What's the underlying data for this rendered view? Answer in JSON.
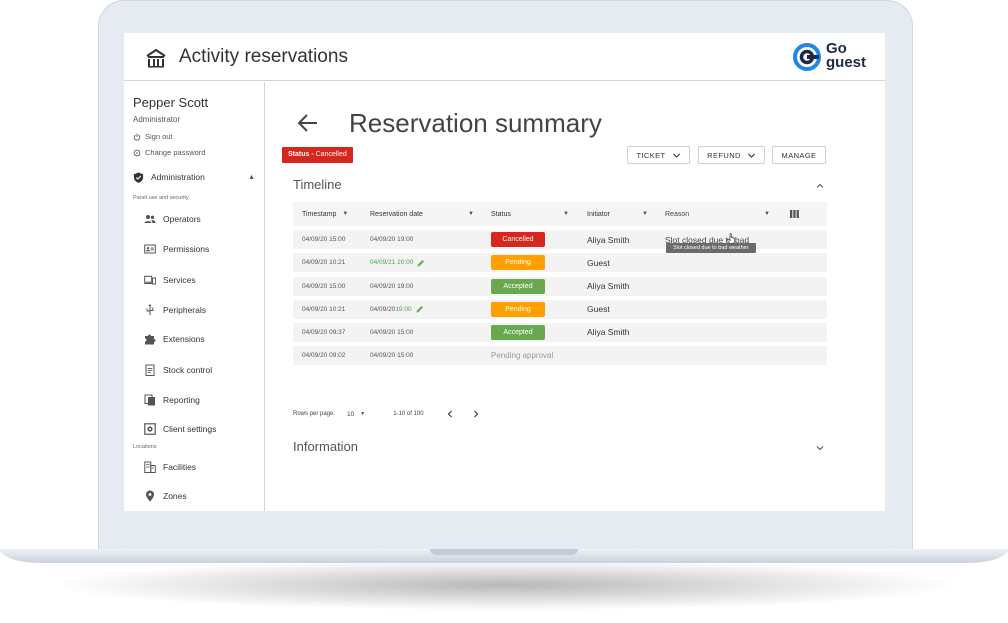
{
  "header": {
    "title": "Activity reservations",
    "brand_line1": "Go",
    "brand_line2": "guest"
  },
  "sidebar": {
    "user_name": "Pepper Scott",
    "user_role": "Administrator",
    "sign_out": "Sign out",
    "change_password": "Change password",
    "section": "Administration",
    "section_caption": "Panel use and security",
    "items": [
      {
        "label": "Operators",
        "icon": "people-icon"
      },
      {
        "label": "Permissions",
        "icon": "id-card-icon"
      },
      {
        "label": "Services",
        "icon": "devices-icon"
      },
      {
        "label": "Peripherals",
        "icon": "usb-icon"
      },
      {
        "label": "Extensions",
        "icon": "puzzle-icon"
      },
      {
        "label": "Stock control",
        "icon": "clipboard-icon"
      },
      {
        "label": "Reporting",
        "icon": "copy-icon"
      },
      {
        "label": "Client settings",
        "icon": "settings-box-icon"
      }
    ],
    "locations_caption": "Locations",
    "location_items": [
      {
        "label": "Facilities",
        "icon": "building-icon"
      },
      {
        "label": "Zones",
        "icon": "location-pin-icon"
      }
    ]
  },
  "main": {
    "title": "Reservation summary",
    "status_prefix": "Status -",
    "status_value": "Cancelled",
    "buttons": {
      "ticket": "TICKET",
      "refund": "REFUND",
      "manage": "MANAGE"
    },
    "timeline_title": "Timeline",
    "information_title": "Information",
    "table": {
      "columns": [
        "Timestamp",
        "Reservation date",
        "Status",
        "Initiator",
        "Reason"
      ],
      "rows": [
        {
          "timestamp": "04/09/20 15:00",
          "date": "04/09/20 19:00",
          "date_changed": false,
          "status": "Cancelled",
          "status_color": "#d9261c",
          "initiator": "Aliya Smith",
          "reason": "Slot closed due to bad"
        },
        {
          "timestamp": "04/09/20 10:21",
          "date": "04/09/21 20:00",
          "date_changed": true,
          "status": "Pending",
          "status_color": "#ffa000",
          "initiator": "Guest",
          "reason": ""
        },
        {
          "timestamp": "04/09/20 15:00",
          "date": "04/09/20 19:00",
          "date_changed": false,
          "status": "Accepted",
          "status_color": "#6aa84f",
          "initiator": "Aliya Smith",
          "reason": ""
        },
        {
          "timestamp": "04/09/20 10:21",
          "date_prefix": "04/09/20 ",
          "date_suffix": "19:00",
          "date_changed": true,
          "status": "Pending",
          "status_color": "#ffa000",
          "initiator": "Guest",
          "reason": ""
        },
        {
          "timestamp": "04/09/20 09:37",
          "date": "04/09/20 15:00",
          "date_changed": false,
          "status": "Accepted",
          "status_color": "#6aa84f",
          "initiator": "Aliya Smith",
          "reason": ""
        },
        {
          "timestamp": "04/09/20 09:02",
          "date": "04/09/20 15:00",
          "date_changed": false,
          "status": "Pending approval",
          "status_color": "",
          "initiator": "",
          "reason": ""
        }
      ],
      "tooltip": "Slot closed due to bad weather"
    },
    "pagination": {
      "rows_label": "Rows per page:",
      "rows_value": "10",
      "range": "1-10 of 100"
    }
  },
  "colors": {
    "status_red": "#d9261c",
    "pending_orange": "#ffa000",
    "accepted_green": "#6aa84f",
    "brand_blue": "#1e88e5"
  }
}
